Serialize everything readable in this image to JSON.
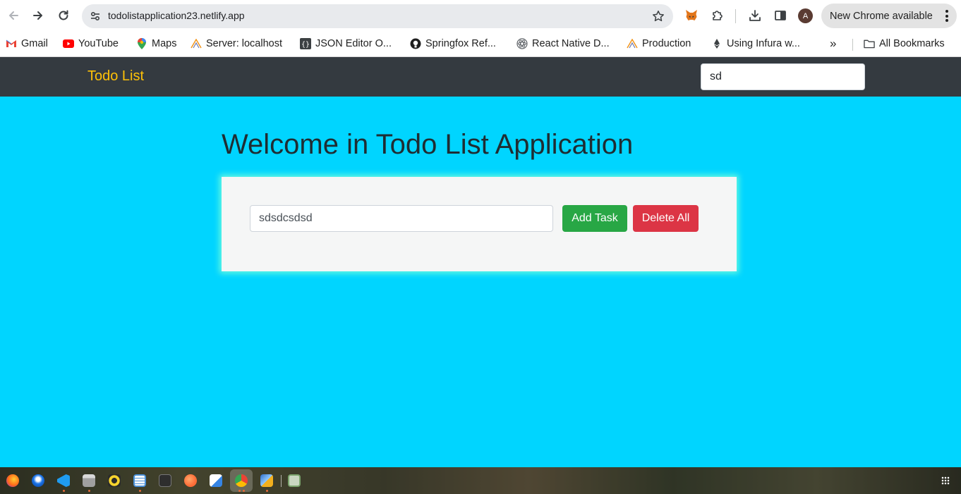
{
  "browser": {
    "url": "todolistapplication23.netlify.app",
    "update_label": "New Chrome available",
    "profile_initial": "A"
  },
  "bookmarks": {
    "items": [
      {
        "label": "Gmail",
        "icon": "gmail-icon"
      },
      {
        "label": "YouTube",
        "icon": "youtube-icon"
      },
      {
        "label": "Maps",
        "icon": "maps-pin-icon"
      },
      {
        "label": "Server: localhost",
        "icon": "phpmyadmin-icon"
      },
      {
        "label": "JSON Editor O...",
        "icon": "json-braces-icon"
      },
      {
        "label": "Springfox Ref...",
        "icon": "github-icon"
      },
      {
        "label": "React Native D...",
        "icon": "react-icon"
      },
      {
        "label": "Production",
        "icon": "phpmyadmin-icon"
      },
      {
        "label": "Using Infura w...",
        "icon": "ethereum-icon"
      }
    ],
    "more": "»",
    "all_bookmarks": "All Bookmarks"
  },
  "app": {
    "brand": "Todo List",
    "search_value": "sd",
    "heading": "Welcome in Todo List Application",
    "task_input_value": "sdsdcsdsd",
    "add_button": "Add Task",
    "delete_button": "Delete All"
  },
  "colors": {
    "navbar": "#343a40",
    "brand": "#ffc107",
    "page_background": "#00d5ff",
    "add_button": "#28a745",
    "delete_button": "#dc3545"
  },
  "taskbar": {
    "apps": [
      "firefox-icon",
      "thunderbird-icon",
      "vscode-icon",
      "files-icon",
      "rhythmbox-icon",
      "text-editor-icon",
      "terminal-icon",
      "postman-icon",
      "notes-icon",
      "chrome-icon",
      "virtualbox-icon",
      "trash-icon"
    ]
  }
}
